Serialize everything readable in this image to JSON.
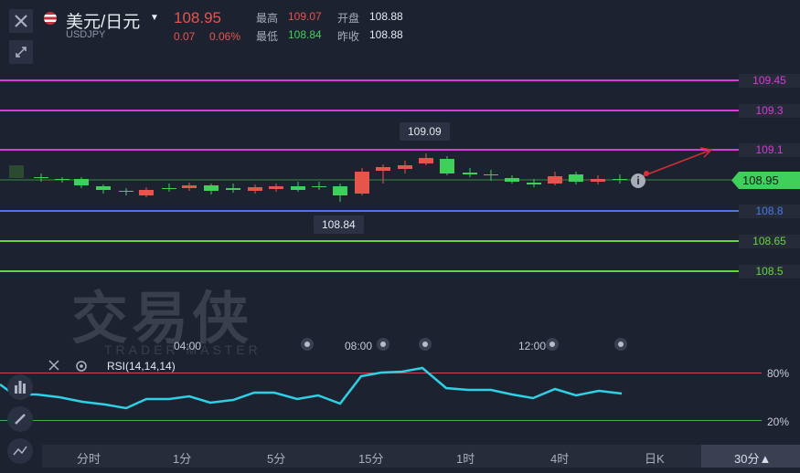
{
  "header": {
    "pair_title": "美元/日元",
    "symbol": "USDJPY",
    "price": "108.95",
    "change": "0.07",
    "change_pct": "0.06%",
    "high_label": "最高",
    "high_value": "109.07",
    "open_label": "开盘",
    "open_value": "108.88",
    "low_label": "最低",
    "low_value": "108.84",
    "prev_close_label": "昨收",
    "prev_close_value": "108.88"
  },
  "levels": [
    {
      "label": "109.45",
      "color": "#d63bd6"
    },
    {
      "label": "109.3",
      "color": "#d63bd6"
    },
    {
      "label": "109.1",
      "color": "#d63bd6"
    },
    {
      "label": "108.8",
      "color": "#4a78e8"
    },
    {
      "label": "108.65",
      "color": "#66d43f"
    },
    {
      "label": "108.5",
      "color": "#66d43f"
    }
  ],
  "current_price_label": "108.95",
  "tooltips": {
    "high": "109.09",
    "low": "108.84"
  },
  "watermark": {
    "cn": "交易侠",
    "en": "TRADER MASTER"
  },
  "time_axis": [
    "04:00",
    "08:00",
    "12:00"
  ],
  "rsi": {
    "label": "RSI(14,14,14)",
    "upper": "80%",
    "lower": "20%"
  },
  "timeframes": [
    "分时",
    "1分",
    "5分",
    "15分",
    "1时",
    "4时",
    "日K",
    "30分▲"
  ],
  "colors": {
    "up": "#e5554c",
    "down": "#3fcf5a",
    "rsi": "#2fd0e6"
  }
}
